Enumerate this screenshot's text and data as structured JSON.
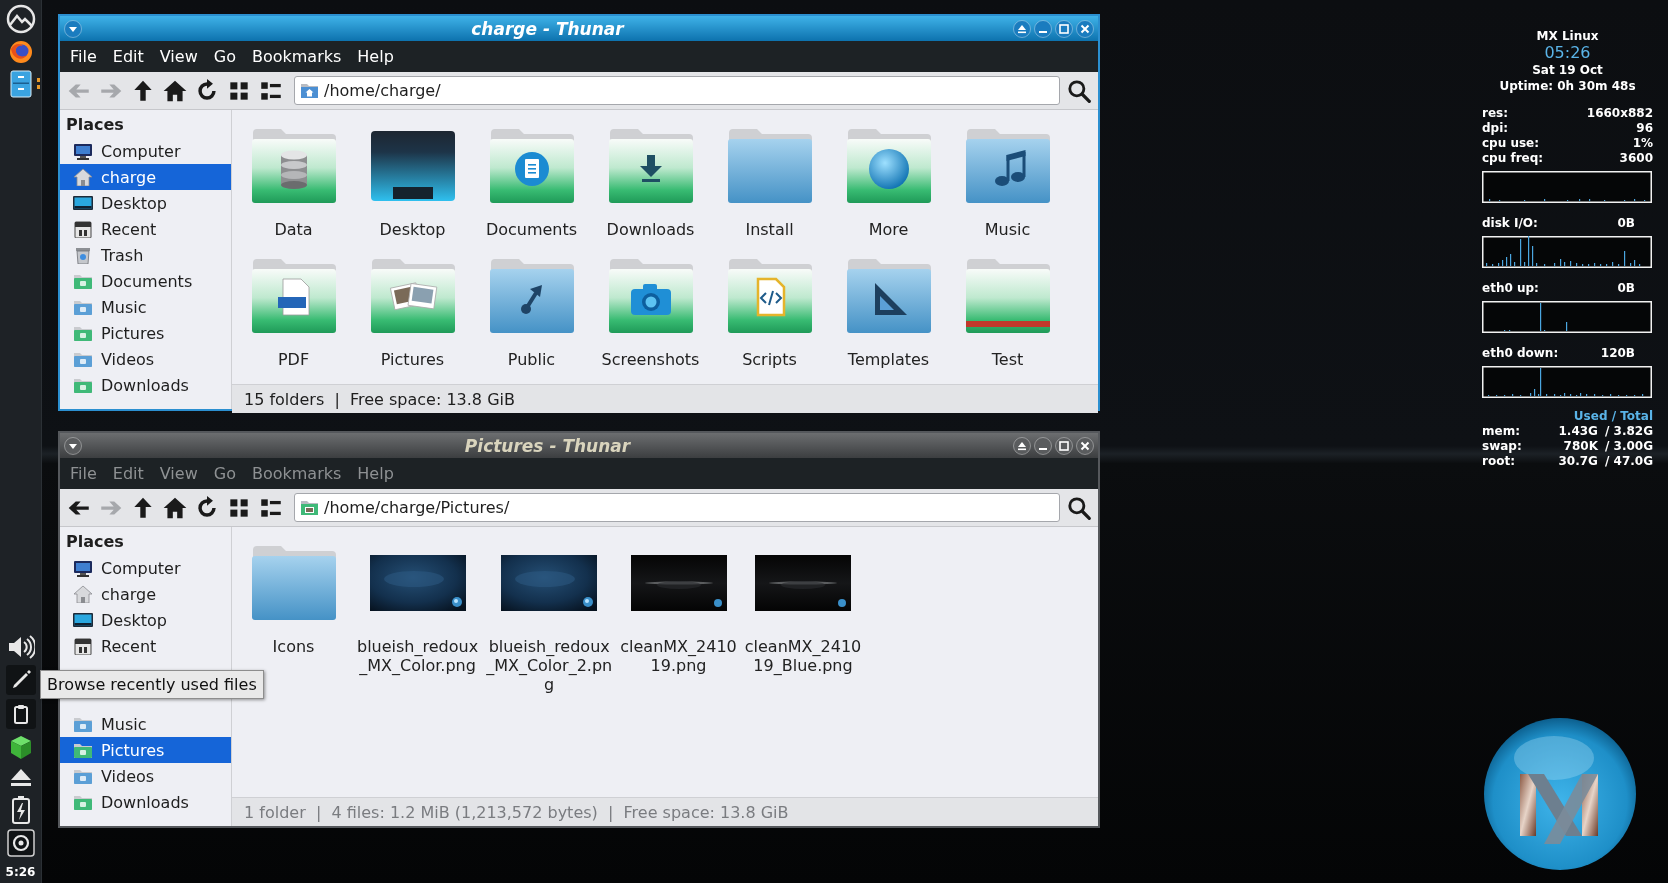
{
  "panel": {
    "clock": "5:26"
  },
  "windows": [
    {
      "title": "charge - Thunar",
      "active": true,
      "menu": [
        "File",
        "Edit",
        "View",
        "Go",
        "Bookmarks",
        "Help"
      ],
      "toolbar": {
        "back_disabled": true,
        "forward_disabled": true
      },
      "location": {
        "text": "/home/charge/",
        "kind": "home"
      },
      "sidebar": {
        "heading": "Places",
        "items": [
          {
            "label": "Computer",
            "kind": "computer",
            "selected": false
          },
          {
            "label": "charge",
            "kind": "home",
            "selected": true
          },
          {
            "label": "Desktop",
            "kind": "desktop",
            "selected": false
          },
          {
            "label": "Recent",
            "kind": "recent",
            "selected": false
          },
          {
            "label": "Trash",
            "kind": "trash",
            "selected": false
          },
          {
            "label": "Documents",
            "kind": "documents",
            "selected": false
          },
          {
            "label": "Music",
            "kind": "music",
            "selected": false
          },
          {
            "label": "Pictures",
            "kind": "pictures",
            "selected": false
          },
          {
            "label": "Videos",
            "kind": "videos",
            "selected": false
          },
          {
            "label": "Downloads",
            "kind": "downloads",
            "selected": false
          }
        ]
      },
      "items": [
        {
          "label": "Data",
          "kind": "data"
        },
        {
          "label": "Desktop",
          "kind": "desktop"
        },
        {
          "label": "Documents",
          "kind": "documents"
        },
        {
          "label": "Downloads",
          "kind": "downloads"
        },
        {
          "label": "Install",
          "kind": "plain"
        },
        {
          "label": "More",
          "kind": "more"
        },
        {
          "label": "Music",
          "kind": "music"
        },
        {
          "label": "PDF",
          "kind": "pdf"
        },
        {
          "label": "Pictures",
          "kind": "photos"
        },
        {
          "label": "Public",
          "kind": "public"
        },
        {
          "label": "Screenshots",
          "kind": "camera"
        },
        {
          "label": "Scripts",
          "kind": "code"
        },
        {
          "label": "Templates",
          "kind": "templates"
        },
        {
          "label": "Test",
          "kind": "test"
        }
      ],
      "status": "15 folders  |  Free space: 13.8 GiB"
    },
    {
      "title": "Pictures - Thunar",
      "active": false,
      "menu": [
        "File",
        "Edit",
        "View",
        "Go",
        "Bookmarks",
        "Help"
      ],
      "toolbar": {
        "back_disabled": false,
        "forward_disabled": true
      },
      "location": {
        "text": "/home/charge/Pictures/",
        "kind": "pictures"
      },
      "sidebar": {
        "heading": "Places",
        "items": [
          {
            "label": "Computer",
            "kind": "computer",
            "selected": false
          },
          {
            "label": "charge",
            "kind": "home",
            "selected": false
          },
          {
            "label": "Desktop",
            "kind": "desktop",
            "selected": false
          },
          {
            "label": "Recent",
            "kind": "recent",
            "selected": false
          }
        ],
        "tooltip": "Browse recently used files",
        "items_below": [
          {
            "label": "Music",
            "kind": "music",
            "selected": false
          },
          {
            "label": "Pictures",
            "kind": "pictures",
            "selected": true
          },
          {
            "label": "Videos",
            "kind": "videos",
            "selected": false
          },
          {
            "label": "Downloads",
            "kind": "downloads",
            "selected": false
          }
        ]
      },
      "items": [
        {
          "label": "Icons",
          "kind": "plain"
        },
        {
          "label": "blueish_redoux\n_MX_Color.png",
          "kind": "bluepicture"
        },
        {
          "label": "blueish_redoux\n_MX_Color_2.pn\ng",
          "kind": "bluepicture"
        },
        {
          "label": "cleanMX_2410\n19.png",
          "kind": "darkpicture"
        },
        {
          "label": "cleanMX_2410\n19_Blue.png",
          "kind": "darkpicture"
        }
      ],
      "status": "1 folder  |  4 files: 1.2 MiB (1,213,572 bytes)  |  Free space: 13.8 GiB"
    }
  ],
  "conky": {
    "title": "MX Linux",
    "time": "05:26",
    "date": "Sat 19 Oct",
    "uptime": "Uptime: 0h 30m 48s",
    "stats": [
      {
        "label": "res:",
        "value": "1660x882"
      },
      {
        "label": "dpi:",
        "value": "96"
      },
      {
        "label": "cpu use:",
        "value": "1%"
      },
      {
        "label": "cpu freq:",
        "value": "3600"
      }
    ],
    "graphs": [
      {
        "label": "disk I/O:",
        "value": "0B"
      },
      {
        "label": "eth0 up:",
        "value": "0B"
      },
      {
        "label": "eth0 down:",
        "value": "120B"
      }
    ],
    "memory_header": "Used / Total",
    "memory": [
      {
        "label": "mem:",
        "used": "1.43G",
        "total": "/ 3.82G"
      },
      {
        "label": "swap:",
        "used": "780K",
        "total": "/ 3.00G"
      },
      {
        "label": "root:",
        "used": "30.7G",
        "total": "/ 47.0G"
      }
    ]
  }
}
